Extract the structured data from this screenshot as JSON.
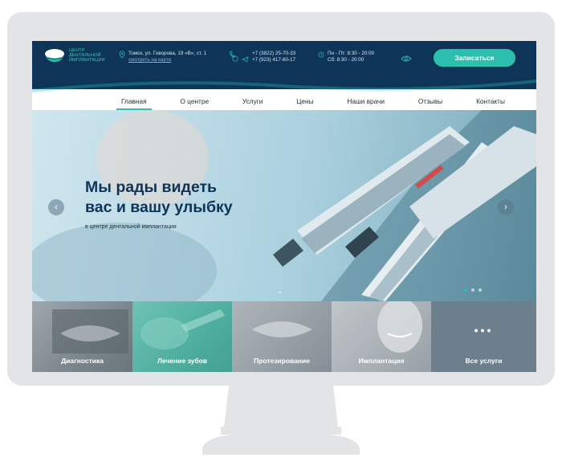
{
  "header": {
    "logo_text": "ЦЕНТР ДЕНТАЛЬНОЙ ИМПЛАНТАЦИИ",
    "address": "Томск, ул. Говорова, 19 «В», ст. 1",
    "map_link": "смотреть на карте",
    "phone_1": "+7 (3822) 25-70-33",
    "phone_2": "+7 (923) 417-60-17",
    "hours_1": "Пн - Пт: 8:30 - 20:00",
    "hours_2": "Сб: 8:30 - 20:00",
    "cta_label": "Записаться"
  },
  "nav": {
    "items": [
      "Главная",
      "О центре",
      "Услуги",
      "Цены",
      "Наши врачи",
      "Отзывы",
      "Контакты"
    ],
    "active": "Главная"
  },
  "hero": {
    "title_line_1": "Мы рады видеть",
    "title_line_2": "вас и вашу улыбку",
    "subtitle": "в центре дентальной имплантации",
    "prev_arrow": "‹",
    "next_arrow": "›",
    "slide_count": 3,
    "active_slide": 1
  },
  "services": [
    {
      "label": "Диагностика"
    },
    {
      "label": "Лечение зубов"
    },
    {
      "label": "Протезирование"
    },
    {
      "label": "Имплантация"
    },
    {
      "label": "Все услуги"
    }
  ],
  "colors": {
    "navy": "#0e3457",
    "teal": "#2cbfae",
    "bezel": "#e3e4e6"
  },
  "icons": [
    "location-pin-icon",
    "phone-icon",
    "whatsapp-icon",
    "telegram-icon",
    "clock-icon",
    "eye-icon",
    "chevron-down-icon",
    "dots-icon"
  ]
}
